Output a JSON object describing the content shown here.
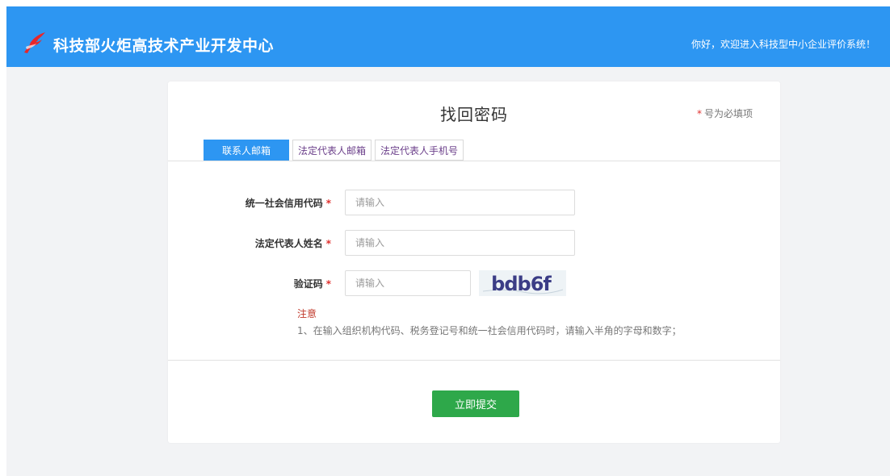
{
  "header": {
    "site_title": "科技部火炬高技术产业开发中心",
    "welcome": "你好，欢迎进入科技型中小企业评价系统！",
    "logo_icon": "torch-logo-icon",
    "bg_color": "#2d96f2"
  },
  "card": {
    "title": "找回密码",
    "required_note": {
      "star": "*",
      "text": "号为必填项"
    },
    "tabs": [
      {
        "label": "联系人邮箱",
        "active": true
      },
      {
        "label": "法定代表人邮箱",
        "active": false
      },
      {
        "label": "法定代表人手机号",
        "active": false
      }
    ],
    "form": {
      "credit_code": {
        "label": "统一社会信用代码",
        "star": "*",
        "placeholder": "请输入"
      },
      "legal_rep_name": {
        "label": "法定代表人姓名",
        "star": "*",
        "placeholder": "请输入"
      },
      "captcha": {
        "label": "验证码",
        "star": "*",
        "placeholder": "请输入",
        "image_text": "bdb6f"
      }
    },
    "notice": {
      "title": "注意",
      "text": "1、在输入组织机构代码、税务登记号和统一社会信用代码时，请输入半角的字母和数字；"
    },
    "submit_label": "立即提交",
    "submit_color": "#2ea84a"
  }
}
